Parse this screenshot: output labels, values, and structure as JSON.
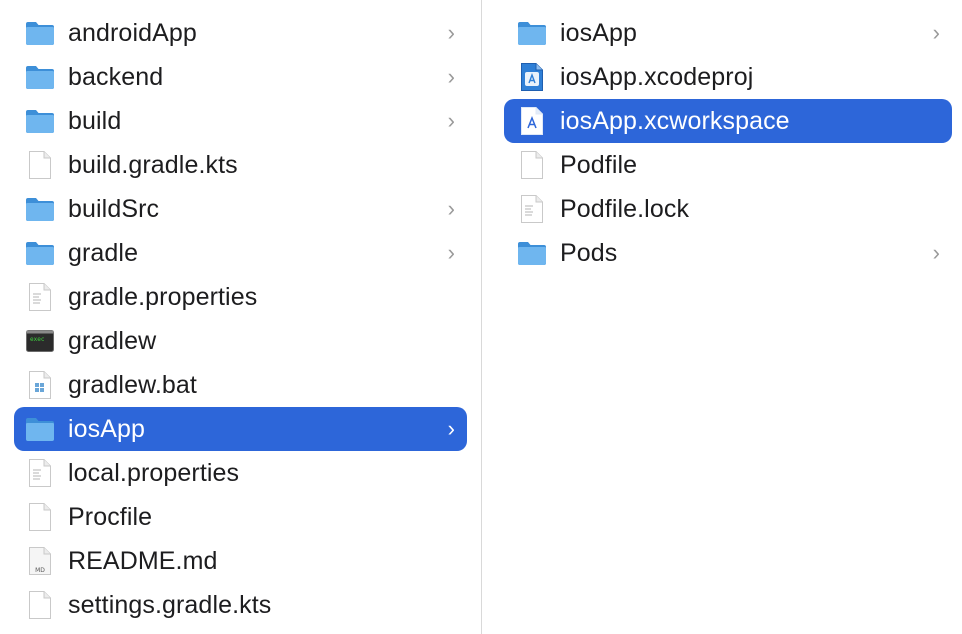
{
  "columns": [
    {
      "items": [
        {
          "label": "androidApp",
          "icon": "folder-icon",
          "chevron": "›"
        },
        {
          "label": "backend",
          "icon": "folder-icon",
          "chevron": "›"
        },
        {
          "label": "build",
          "icon": "folder-icon",
          "chevron": "›"
        },
        {
          "label": "build.gradle.kts",
          "icon": "blank-document-icon"
        },
        {
          "label": "buildSrc",
          "icon": "folder-icon",
          "chevron": "›"
        },
        {
          "label": "gradle",
          "icon": "folder-icon",
          "chevron": "›"
        },
        {
          "label": "gradle.properties",
          "icon": "text-document-icon"
        },
        {
          "label": "gradlew",
          "icon": "terminal-executable-icon"
        },
        {
          "label": "gradlew.bat",
          "icon": "windows-batch-file-icon"
        },
        {
          "label": "iosApp",
          "icon": "folder-icon",
          "chevron": "›",
          "selected": true
        },
        {
          "label": "local.properties",
          "icon": "text-document-icon"
        },
        {
          "label": "Procfile",
          "icon": "blank-document-icon"
        },
        {
          "label": "README.md",
          "icon": "markdown-document-icon",
          "badge": "MD"
        },
        {
          "label": "settings.gradle.kts",
          "icon": "blank-document-icon"
        }
      ]
    },
    {
      "items": [
        {
          "label": "iosApp",
          "icon": "folder-icon",
          "chevron": "›"
        },
        {
          "label": "iosApp.xcodeproj",
          "icon": "xcodeproj-icon"
        },
        {
          "label": "iosApp.xcworkspace",
          "icon": "xcworkspace-icon",
          "selected": true
        },
        {
          "label": "Podfile",
          "icon": "blank-document-icon"
        },
        {
          "label": "Podfile.lock",
          "icon": "text-document-icon"
        },
        {
          "label": "Pods",
          "icon": "folder-icon",
          "chevron": "›"
        }
      ]
    }
  ],
  "colors": {
    "selection": "#2d66d9",
    "folder": "#5aa9ea"
  }
}
